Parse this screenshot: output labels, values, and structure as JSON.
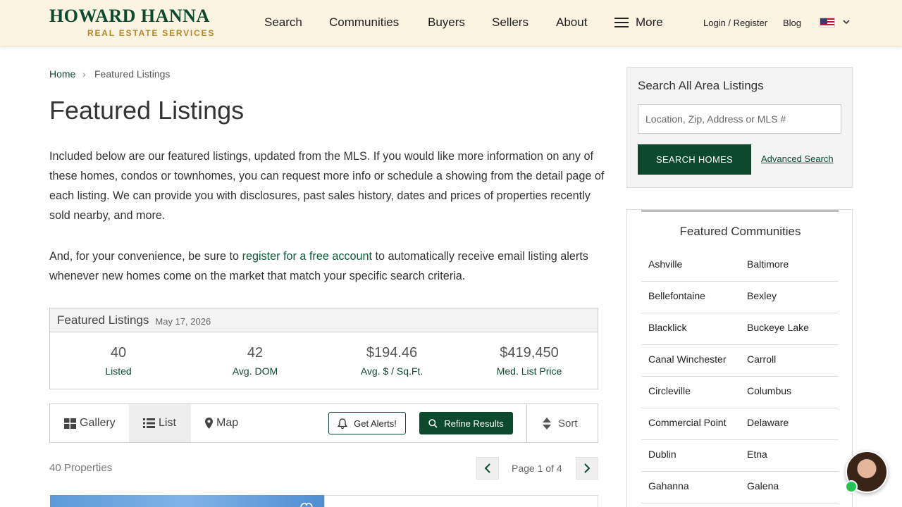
{
  "header": {
    "logo_main": "HOWARD HANNA",
    "logo_sub": "REAL ESTATE SERVICES",
    "nav": [
      "Search",
      "Communities",
      "Buyers",
      "Sellers",
      "About"
    ],
    "more_label": "More",
    "login_label": "Login / Register",
    "blog_label": "Blog",
    "locale_flag": "us-flag-icon"
  },
  "breadcrumb": {
    "home": "Home",
    "separator": "›",
    "current": "Featured Listings"
  },
  "page_title": "Featured Listings",
  "intro": {
    "p1": "Included below are our featured listings, updated from the MLS. If you would like more information on any of these homes, condos or townhomes, you can request more info or schedule a showing from the detail page of each listing. We can provide you with disclosures, past sales history, dates and prices of properties recently sold nearby, and more.",
    "p2_before": "And, for your convenience, be sure to ",
    "p2_link": "register for a free account",
    "p2_after": " to automatically receive email listing alerts whenever new homes come on the market that match your specific search criteria."
  },
  "stats": {
    "title": "Featured Listings",
    "date": "May 17, 2026",
    "items": [
      {
        "value": "40",
        "label": "Listed"
      },
      {
        "value": "42",
        "label": "Avg. DOM"
      },
      {
        "value": "$194.46",
        "label": "Avg. $ / Sq.Ft."
      },
      {
        "value": "$419,450",
        "label": "Med. List Price"
      }
    ]
  },
  "toolbar": {
    "views": [
      "Gallery",
      "List",
      "Map"
    ],
    "active_view": "List",
    "alerts_label": "Get Alerts!",
    "refine_label": "Refine Results",
    "sort_label": "Sort"
  },
  "results": {
    "count": "40 Properties",
    "page_text": "Page 1 of 4"
  },
  "sidebar": {
    "search_title": "Search All Area Listings",
    "search_placeholder": "Location, Zip, Address or MLS #",
    "search_button": "SEARCH HOMES",
    "advanced_link": "Advanced Search",
    "communities_title": "Featured Communities",
    "communities": [
      [
        "Ashville",
        "Baltimore"
      ],
      [
        "Bellefontaine",
        "Bexley"
      ],
      [
        "Blacklick",
        "Buckeye Lake"
      ],
      [
        "Canal Winchester",
        "Carroll"
      ],
      [
        "Circleville",
        "Columbus"
      ],
      [
        "Commercial Point",
        "Delaware"
      ],
      [
        "Dublin",
        "Etna"
      ],
      [
        "Gahanna",
        "Galena"
      ]
    ]
  },
  "colors": {
    "brand_green": "#0b4a2c",
    "brand_gold": "#b6862c",
    "header_bg": "#fbf4e1"
  }
}
